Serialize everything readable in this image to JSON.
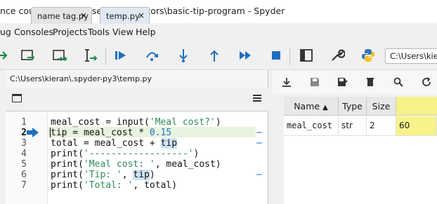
{
  "window": {
    "title": "nce course\\lessons\\useful-calculators\\basic-tip-program - Spyder"
  },
  "menu": [
    "ug",
    "Consoles",
    "Projects",
    "Tools",
    "View",
    "Help"
  ],
  "toolbar": {
    "path": "C:\\Users\\kieran",
    "icons": [
      "run-icon",
      "run-cell-icon",
      "run-cell-advance-icon",
      "run-selection-icon",
      "debug-icon",
      "step-icon",
      "step-into-icon",
      "step-return-icon",
      "continue-icon",
      "stop-icon",
      "maximize-pane-icon",
      "preferences-icon",
      "python-path-icon"
    ],
    "accent": "#1f6fc0"
  },
  "editor": {
    "filepath": "C:\\Users\\kieran\\.spyder-py3\\temp.py",
    "tabs": [
      {
        "label": "name tag.py",
        "close": "×",
        "active": false
      },
      {
        "label": "temp.py",
        "close": "×",
        "active": true
      }
    ],
    "line_numbers": [
      "1",
      "2",
      "3",
      "4",
      "5",
      "6",
      "7"
    ],
    "current_line": 2,
    "lines": [
      "meal_cost = input('Meal cost?')",
      "tip = meal_cost * 0.15",
      "total = meal_cost + tip",
      "print('------------------')",
      "print('Meal cost: ', meal_cost)",
      "print('Tip: ', tip)",
      "print('Total: ', total)"
    ]
  },
  "variable_explorer": {
    "columns": [
      "Name",
      "Type",
      "Size",
      ""
    ],
    "rows": [
      {
        "name": "meal_cost",
        "type": "str",
        "size": "2",
        "value": "60"
      }
    ],
    "highlight_color": "#f7f28a"
  }
}
